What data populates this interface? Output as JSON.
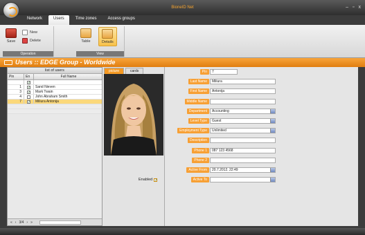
{
  "app": {
    "title": "BioneID Net",
    "window_controls": [
      "–",
      "▫",
      "x"
    ]
  },
  "tabs": [
    {
      "label": "Network",
      "active": false
    },
    {
      "label": "Users",
      "active": true
    },
    {
      "label": "Time zones",
      "active": false
    },
    {
      "label": "Access groups",
      "active": false
    }
  ],
  "ribbon": {
    "operation_group": {
      "label": "Operation",
      "save": "Save",
      "new": "New",
      "delete": "Delete"
    },
    "view_group": {
      "label": "View",
      "table": "Table",
      "details": "Details"
    }
  },
  "header": {
    "title": "Users :: EDGE Group - Worldwide"
  },
  "list": {
    "title": "list of users",
    "columns": [
      "Pin",
      "En",
      "Full Name"
    ],
    "rows": [
      {
        "pin": "1",
        "enabled": true,
        "name": "Sand  Nieven",
        "selected": false
      },
      {
        "pin": "3",
        "enabled": true,
        "name": "Mark  Twain",
        "selected": false
      },
      {
        "pin": "4",
        "enabled": false,
        "name": "John Abraham Smith",
        "selected": false
      },
      {
        "pin": "7",
        "enabled": true,
        "name": "Miliura  Antonija",
        "selected": true
      }
    ],
    "pager": {
      "page": "3/4"
    }
  },
  "picture": {
    "tabs": [
      "picture",
      "cards"
    ],
    "enabled_label": "Enabled",
    "enabled": true
  },
  "form": {
    "fields": [
      {
        "label": "Pin",
        "value": "7",
        "dropdown": false
      },
      {
        "label": "Last Name",
        "value": "Miliura",
        "dropdown": false
      },
      {
        "label": "First Name",
        "value": "Antonija",
        "dropdown": false
      },
      {
        "label": "Middle Name",
        "value": "",
        "dropdown": false
      },
      {
        "label": "Department",
        "value": "Accounting",
        "dropdown": true
      },
      {
        "label": "Level Type",
        "value": "Guest",
        "dropdown": true
      },
      {
        "label": "Employment Type",
        "value": "Unlimited",
        "dropdown": true
      },
      {
        "label": "Description",
        "value": "",
        "dropdown": false
      },
      {
        "label": "Phone 1",
        "value": "087 123 4568",
        "dropdown": false
      },
      {
        "label": "Phone 2",
        "value": "",
        "dropdown": false
      },
      {
        "label": "Active From",
        "value": "20.7.2012. 22:49",
        "dropdown": true
      },
      {
        "label": "Active To",
        "value": "",
        "dropdown": true
      }
    ]
  },
  "colors": {
    "accent": "#f39a1a",
    "selected_row": "#fbd87a"
  }
}
